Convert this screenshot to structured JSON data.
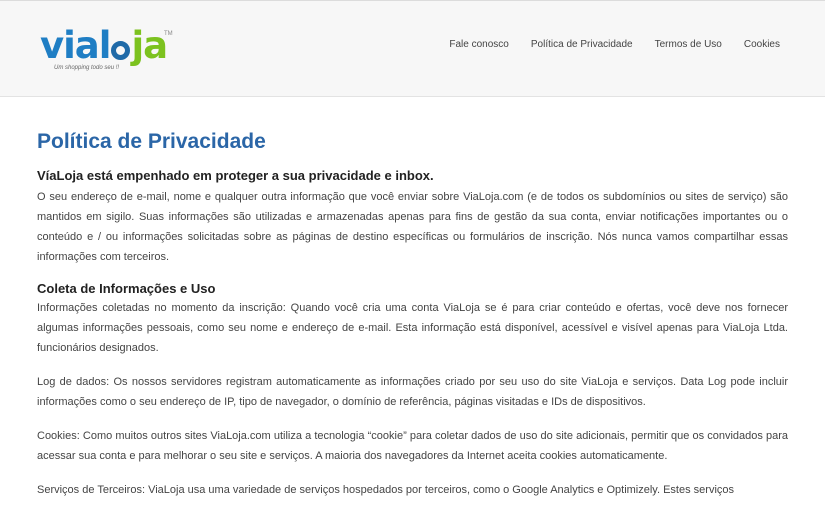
{
  "header": {
    "logo": {
      "via": "via",
      "l": "l",
      "ja": "ja",
      "tagline": "Um shopping todo seu !!",
      "tm": "TM"
    },
    "nav": [
      "Fale conosco",
      "Política de Privacidade",
      "Termos de Uso",
      "Cookies"
    ]
  },
  "main": {
    "title": "Política de Privacidade",
    "subtitle": "VíaLoja está empenhado em proteger a sua privacidade e inbox.",
    "intro": "O seu endereço de e-mail, nome e qualquer outra informação que você enviar sobre ViaLoja.com (e de todos os subdomínios ou sites de serviço) são mantidos em sigilo. Suas informações são utilizadas e armazenadas apenas para fins de gestão da sua conta, enviar notificações importantes ou o conteúdo e / ou informações solicitadas sobre as páginas de destino específicas ou formulários de inscrição. Nós nunca vamos compartilhar essas informações com terceiros.",
    "section_title": "Coleta de Informações e Uso",
    "paragraphs": [
      "Informações coletadas no momento da inscrição: Quando você cria uma conta ViaLoja se é para criar conteúdo e ofertas, você deve nos fornecer algumas informações pessoais, como seu nome e endereço de e-mail. Esta informação está disponível, acessível e visível apenas para ViaLoja Ltda. funcionários designados.",
      "Log de dados: Os nossos servidores registram automaticamente as informações criado por seu uso do site ViaLoja e serviços. Data Log pode incluir informações como o seu endereço de IP, tipo de navegador, o domínio de referência, páginas visitadas e IDs de dispositivos.",
      "Cookies: Como muitos outros sites ViaLoja.com utiliza a tecnologia “cookie” para coletar dados de uso do site adicionais, permitir que os convidados para acessar sua conta e para melhorar o seu site e serviços. A maioria dos navegadores da Internet aceita cookies automaticamente.",
      "Serviços de Terceiros: ViaLoja usa uma variedade de serviços hospedados por terceiros, como o Google Analytics e Optimizely. Estes serviços"
    ]
  },
  "colors": {
    "brand_blue": "#1f7ec4",
    "brand_green": "#7cc21f",
    "title_blue": "#2b66a7"
  }
}
